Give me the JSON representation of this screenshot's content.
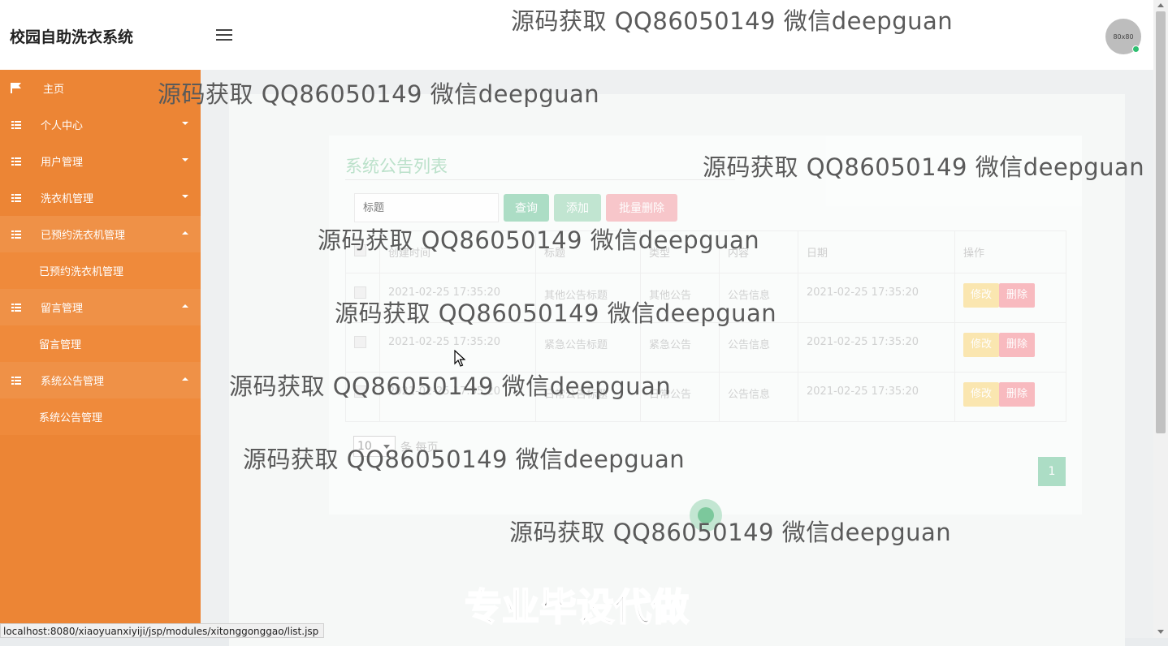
{
  "app": {
    "title": "校园自助洗衣系统",
    "avatar_text": "80x80"
  },
  "sidebar": {
    "items": [
      {
        "label": "主页",
        "icon": "flag-icon",
        "caret": ""
      },
      {
        "label": "个人中心",
        "icon": "grid-icon",
        "caret": "down"
      },
      {
        "label": "用户管理",
        "icon": "grid-icon",
        "caret": "down"
      },
      {
        "label": "洗衣机管理",
        "icon": "grid-icon",
        "caret": "down"
      },
      {
        "label": "已预约洗衣机管理",
        "icon": "grid-icon",
        "caret": "up",
        "sub": "已预约洗衣机管理"
      },
      {
        "label": "留言管理",
        "icon": "grid-icon",
        "caret": "up",
        "sub": "留言管理"
      },
      {
        "label": "系统公告管理",
        "icon": "grid-icon",
        "caret": "up",
        "sub": "系统公告管理"
      }
    ]
  },
  "main": {
    "card_title": "系统公告列表",
    "search_placeholder": "标题",
    "buttons": {
      "query": "查询",
      "add": "添加",
      "batch_delete": "批量删除"
    },
    "table": {
      "headers": [
        "",
        "创建时间",
        "标题",
        "类型",
        "内容",
        "日期",
        "操作"
      ],
      "rows": [
        {
          "created": "2021-02-25 17:35:20",
          "title": "其他公告标题",
          "type": "其他公告",
          "content": "公告信息",
          "date": "2021-02-25 17:35:20"
        },
        {
          "created": "2021-02-25 17:35:20",
          "title": "紧急公告标题",
          "type": "紧急公告",
          "content": "公告信息",
          "date": "2021-02-25 17:35:20"
        },
        {
          "created": "2021-02-25 17:35:20",
          "title": "日常公告标题",
          "type": "日常公告",
          "content": "公告信息",
          "date": "2021-02-25 17:35:20"
        }
      ],
      "edit_label": "修改",
      "delete_label": "删除"
    },
    "pager": {
      "page_size": "10",
      "per_page_text": "条 每页",
      "current_page": "1"
    }
  },
  "watermarks": {
    "text": "源码获取 QQ86050149 微信deepguan",
    "big_text": "专业毕设代做"
  },
  "statusbar": {
    "url": "localhost:8080/xiaoyuanxiyiji/jsp/modules/xitonggonggao/list.jsp"
  },
  "colors": {
    "sidebar": "#ec8535",
    "primary_green": "#a9dcc3",
    "danger_pink": "#f8c4c8",
    "warning_yellow": "#fbe6ad"
  }
}
